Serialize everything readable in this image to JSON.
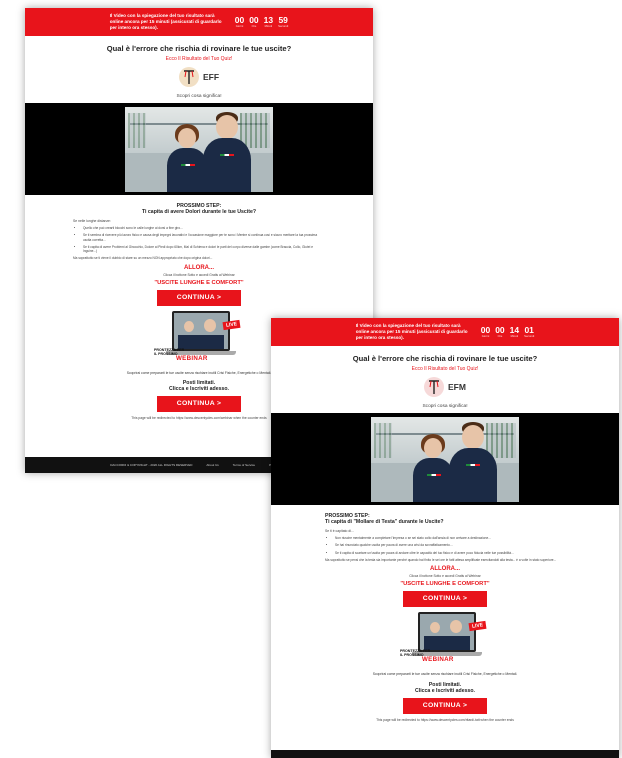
{
  "pages": [
    {
      "banner": "Il Video con la spiegazione del tuo risultato sarà online ancora per 15 minuti (assicurati di guardarlo per intero ora stesso).",
      "timer": {
        "d": "00",
        "h": "00",
        "m": "13",
        "s": "59",
        "label_d": "Giorni",
        "label_h": "Ore",
        "label_m": "Minuti",
        "label_s": "Secondi"
      },
      "title": "Qual è l'errore che rischia di rovinare le tue uscite?",
      "result_label": "Ecco Il Risultato del Tuo Quiz!",
      "result_code": "EFF",
      "discover": "Scopri cosa significa!",
      "step_line1": "PROSSIMO STEP:",
      "step_line2": "Ti capita di avere Dolori durante le tue Uscite?",
      "intro": "Se nelle lunghe distanze:",
      "bullets": [
        "Quello che può crearti blocchi sono le calle lunghe ai dorsi a fine giro...",
        "Se ti sembra di ricevere più lavoro fisico e causa degli impegni lavorativi e l'occasione maggiore per te sono i Mentre si continua così e sicuro meritare la tua prossima uscita corretta...",
        "Se ti capita di avere Problemi al Ginocchio, Dolore ai Piedi dopo 60km, Mal di Schiena e dolori le parti del corpo diverse dalle gambe (come Braccia, Collo, Glutei e Inguine...)"
      ],
      "note": "Ma soprattutto se ti viene il dubbio di stare su un mezzo NON appropriato che dopo origina dolori...",
      "allora": "ALLORA...",
      "clicca": "Clicca il bottone Sotto e accedi Gratis al Webinar",
      "uscite": "\"USCITE LUNGHE E COMFORT\"",
      "cta": "CONTINUA  >",
      "webinar_live": "LIVE",
      "webinar_pre": "PRONTEZZA PER IL PROSSIMO",
      "webinar_word": "WEBINAR",
      "scopri": "Scoprirai come prepararti le tue uscite senza rischiare inutili Crisi Fisiche, Energetiche o Mentali.",
      "posti1": "Posti limitati.",
      "posti2": "Clicca e Iscriviti adesso.",
      "redirect": "This page will be redirected to https://www.descentycles.com/webinar when the counter ends",
      "footer": [
        "DACCORDI & COPYRIGHT - 2020 ALL RIGHTS RESERVED",
        "About Us",
        "Terms of Service",
        "Privacy Policy"
      ]
    },
    {
      "banner": "Il Video con la spiegazione del tuo risultato sarà online ancora per 15 minuti (assicurati di guardarlo per intero ora stesso).",
      "timer": {
        "d": "00",
        "h": "00",
        "m": "14",
        "s": "01",
        "label_d": "Giorni",
        "label_h": "Ore",
        "label_m": "Minuti",
        "label_s": "Secondi"
      },
      "title": "Qual è l'errore che rischia di rovinare le tue uscite?",
      "result_label": "Ecco Il Risultato del Tuo Quiz!",
      "result_code": "EFM",
      "discover": "Scopri cosa significa!",
      "step_line1": "PROSSIMO STEP:",
      "step_line2": "Ti capita di \"Mollare di Testa\" durante le Uscite?",
      "intro": "Se ti è capitato di...",
      "bullets": [
        "Non riuscire mentalmente a completare l'impresa o se sei stato colto dall'ansia di non arrivare a destinazione...",
        "Se hai rinunciato qualche uscita per paura di avere una crisi da sovraffaticamento...",
        "Se ti capita di scartare un'uscita per paura di andare oltre le capacità del tuo fisico e di avere poco fiducia nelle tue possibilità..."
      ],
      "note": "Ma soprattutto se pensi che la testa sia importante perché quando hai finito le sei ore le fatti attesa amplificate esercitandoti alla testa... è a volte in stato superiore...",
      "allora": "ALLORA...",
      "clicca": "Clicca il bottone Sotto e accedi Gratis al Webinar",
      "uscite": "\"USCITE LUNGHE E COMFORT\"",
      "cta": "CONTINUA  >",
      "webinar_live": "LIVE",
      "webinar_pre": "PRONTEZZA PER IL PROSSIMO",
      "webinar_word": "WEBINAR",
      "scopri": "Scoprirai come prepararti le tue uscite senza rischiare inutili Crisi Fisiche, Energetiche o Mentali.",
      "posti1": "Posti limitati.",
      "posti2": "Clicca e Iscriviti adesso.",
      "redirect": "This page will be redirected to https://www.descentycles.com/ritardi-tatt when the counter ends",
      "footer": []
    }
  ],
  "colors": {
    "accent": "#e8141b",
    "video_bg": "#000000",
    "footer_bg": "#111111"
  },
  "icons": {
    "logo": "bike-logo-icon"
  }
}
